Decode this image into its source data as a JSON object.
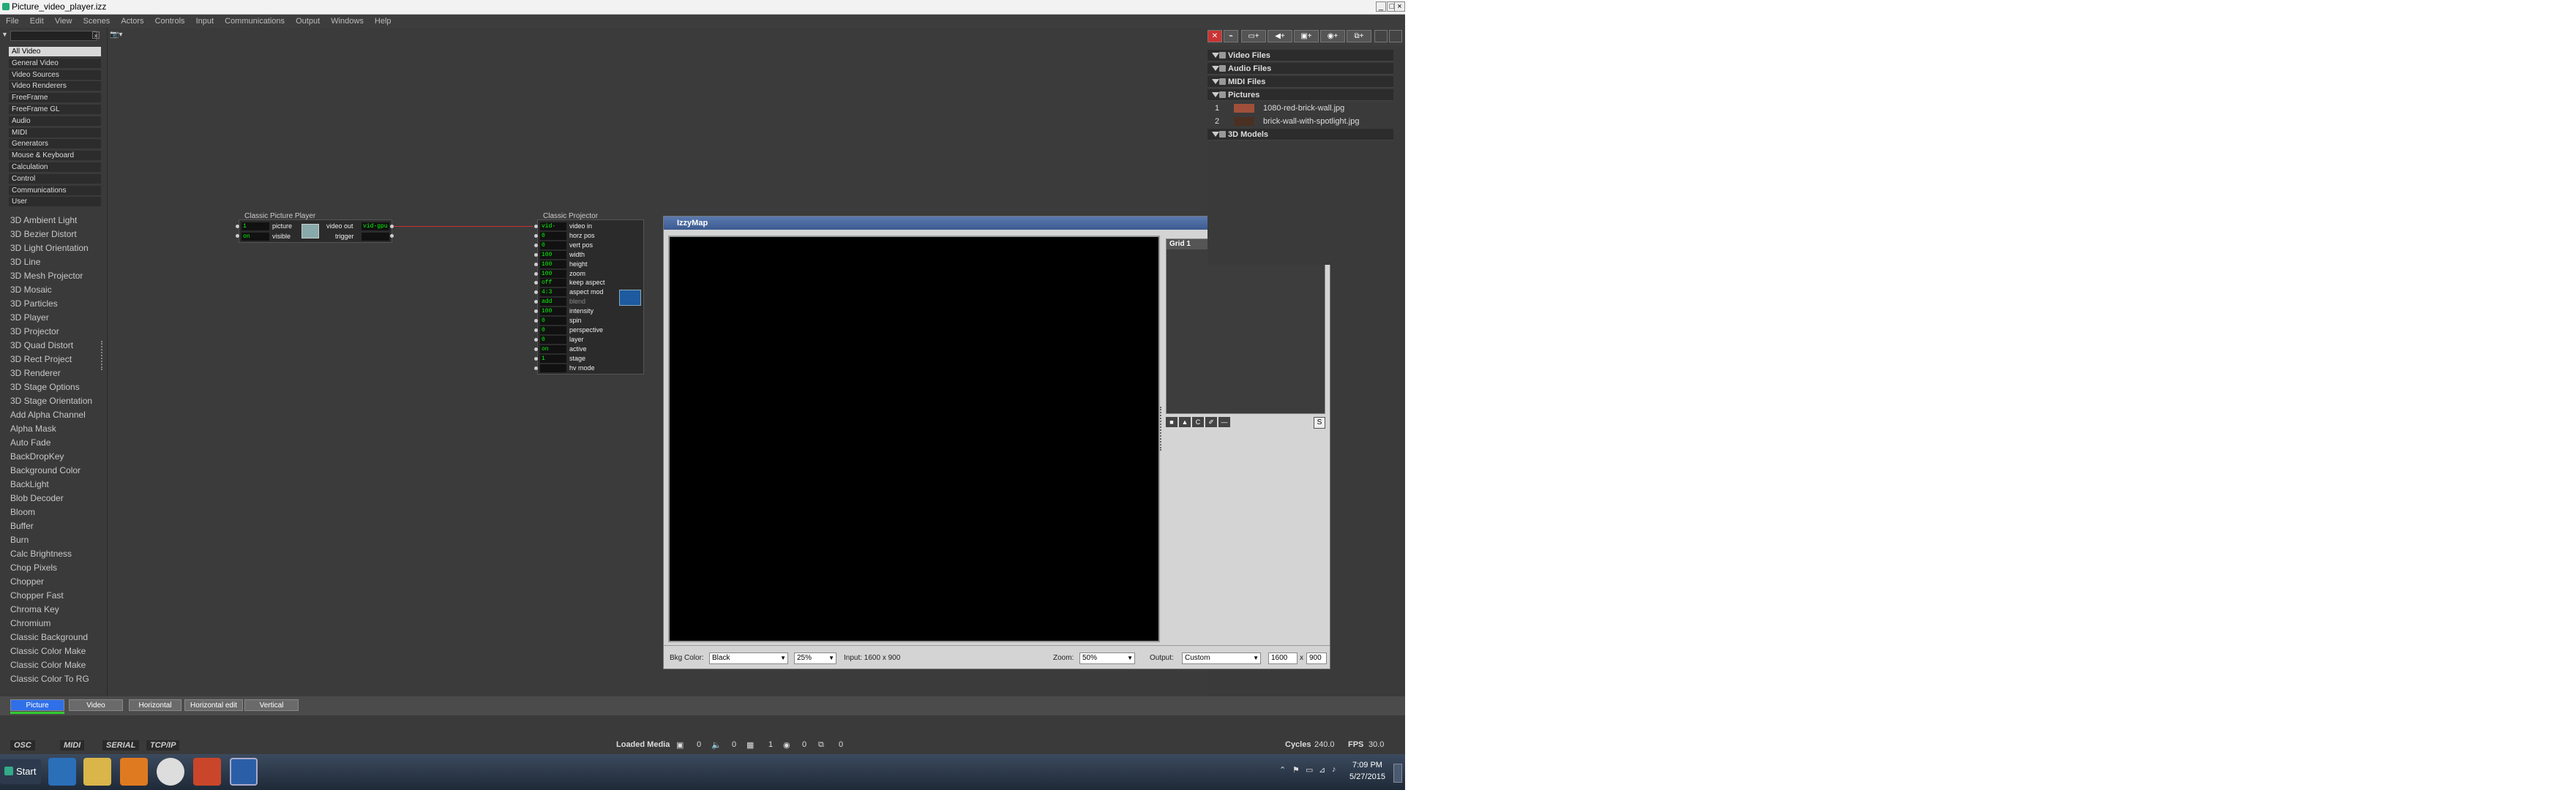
{
  "window": {
    "title": "Picture_video_player.izz"
  },
  "menu": [
    "File",
    "Edit",
    "View",
    "Scenes",
    "Actors",
    "Controls",
    "Input",
    "Communications",
    "Output",
    "Windows",
    "Help"
  ],
  "library": {
    "categories": [
      "All Video",
      "General Video",
      "Video Sources",
      "Video Renderers",
      "FreeFrame",
      "FreeFrame GL",
      "Audio",
      "MIDI",
      "Generators",
      "Mouse & Keyboard",
      "Calculation",
      "Control",
      "Communications",
      "User"
    ],
    "selected_category": "All Video",
    "actors": [
      "3D Ambient Light",
      "3D Bezier Distort",
      "3D Light Orientation",
      "3D Line",
      "3D Mesh Projector",
      "3D Mosaic",
      "3D Particles",
      "3D Player",
      "3D Projector",
      "3D Quad Distort",
      "3D Rect Project",
      "3D Renderer",
      "3D Stage Options",
      "3D Stage Orientation",
      "Add Alpha Channel",
      "Alpha Mask",
      "Auto Fade",
      "BackDropKey",
      "Background Color",
      "BackLight",
      "Blob Decoder",
      "Bloom",
      "Buffer",
      "Burn",
      "Calc Brightness",
      "Chop Pixels",
      "Chopper",
      "Chopper Fast",
      "Chroma Key",
      "Chromium",
      "Classic Background",
      "Classic Color Make",
      "Classic Color Make",
      "Classic Color To RG"
    ]
  },
  "picture_player": {
    "title": "Classic Picture Player",
    "inputs": [
      {
        "value": "1 [brick-w",
        "label": "picture"
      },
      {
        "value": "on",
        "label": "visible"
      }
    ],
    "outputs": [
      {
        "label": "video out",
        "value": "vid-gpu"
      },
      {
        "label": "trigger",
        "value": ""
      }
    ]
  },
  "projector": {
    "title": "Classic Projector",
    "ports": [
      {
        "value": "vid-gpu",
        "label": "video in"
      },
      {
        "value": "0",
        "label": "horz pos"
      },
      {
        "value": "0",
        "label": "vert pos"
      },
      {
        "value": "100",
        "label": "width"
      },
      {
        "value": "100",
        "label": "height"
      },
      {
        "value": "100",
        "label": "zoom"
      },
      {
        "value": "off",
        "label": "keep aspect"
      },
      {
        "value": "4:3",
        "label": "aspect mod"
      },
      {
        "value": "add",
        "label": "blend"
      },
      {
        "value": "100",
        "label": "intensity"
      },
      {
        "value": "0",
        "label": "spin"
      },
      {
        "value": "0",
        "label": "perspective"
      },
      {
        "value": "0",
        "label": "layer"
      },
      {
        "value": "on",
        "label": "active"
      },
      {
        "value": "1",
        "label": "stage"
      },
      {
        "value": "",
        "label": "hv mode"
      }
    ]
  },
  "izzymap": {
    "title": "IzzyMap",
    "grid_title": "Grid 1",
    "bkg_label": "Bkg Color:",
    "bkg_value": "Black",
    "zoom_small": "25%",
    "input_text": "Input: 1600 x 900",
    "zoom_label": "Zoom:",
    "zoom_value": "50%",
    "output_label": "Output:",
    "output_value": "Custom",
    "out_w": "1600",
    "out_h": "900",
    "grid_buttons": [
      "■",
      "▲",
      "C",
      "✐",
      "—"
    ],
    "s_button": "S"
  },
  "media": {
    "sections": [
      "Video Files",
      "Audio Files",
      "MIDI Files",
      "Pictures",
      "3D Models"
    ],
    "pictures": [
      {
        "num": "1",
        "name": "1080-red-brick-wall.jpg"
      },
      {
        "num": "2",
        "name": "brick-wall-with-spotlight.jpg"
      }
    ]
  },
  "tabs": [
    "Picture",
    "Video",
    "Horizontal",
    "Horizontal edit",
    "Vertical"
  ],
  "active_tab": "Picture",
  "status": {
    "protocols": [
      "OSC",
      "MIDI",
      "SERIAL",
      "TCP/IP"
    ],
    "loaded_media_label": "Loaded Media",
    "counts": [
      "0",
      "0",
      "1",
      "0",
      "0"
    ],
    "cycles_label": "Cycles",
    "cycles_value": "240.0",
    "fps_label": "FPS",
    "fps_value": "30.0"
  },
  "taskbar": {
    "start": "Start",
    "time": "7:09 PM",
    "date": "5/27/2015"
  },
  "colors": {
    "accent_tab": "#2f6fe8",
    "link_line": "#c83232",
    "value_text": "#00ff00"
  }
}
